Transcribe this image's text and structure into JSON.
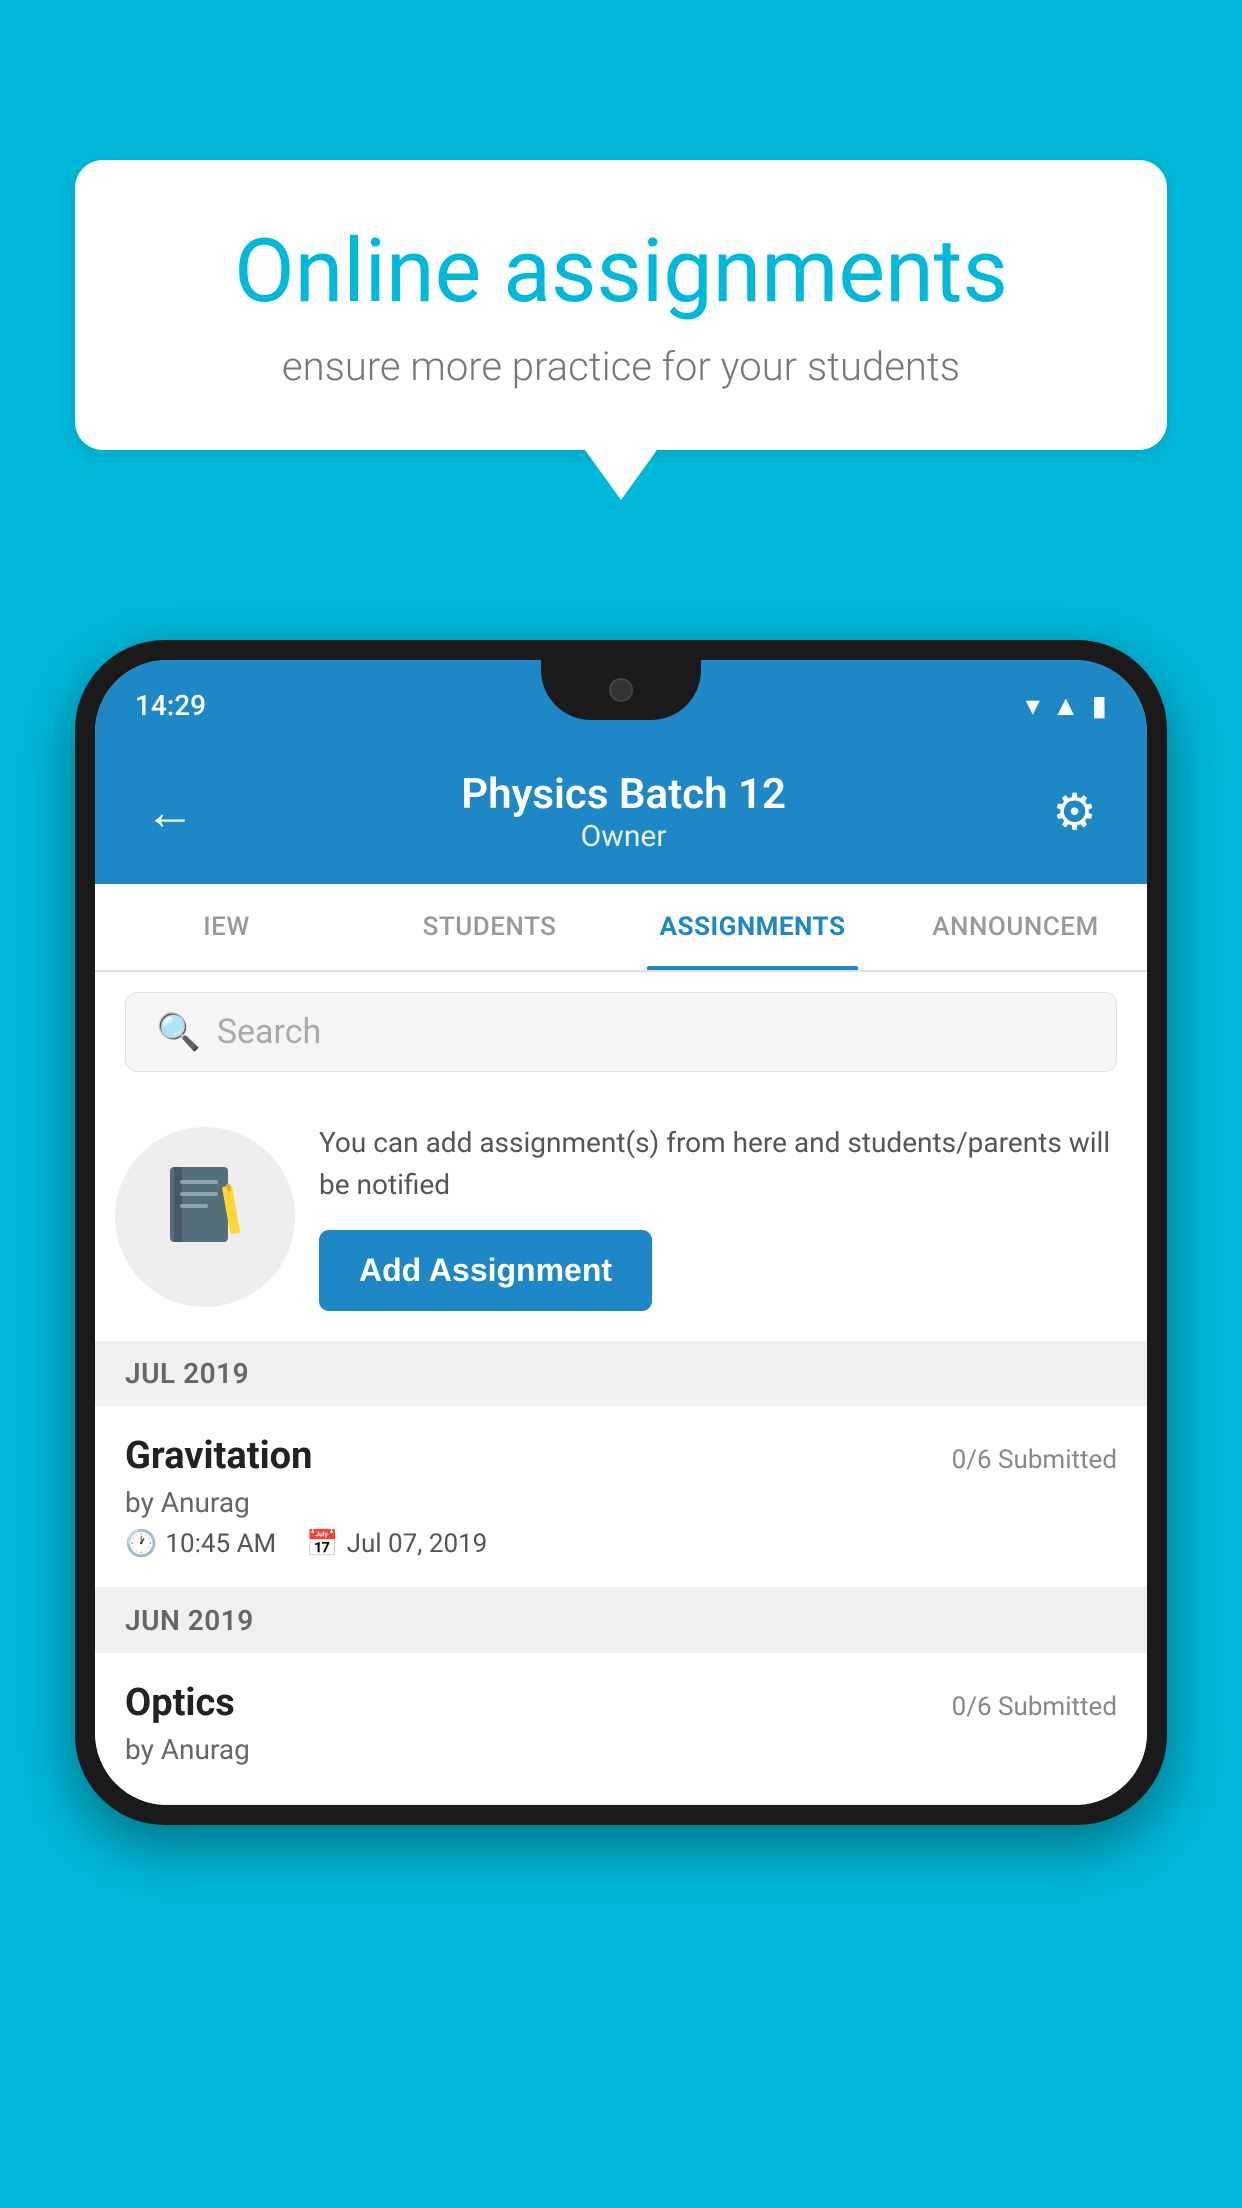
{
  "background_color": "#00b8d9",
  "speech_bubble": {
    "title": "Online assignments",
    "subtitle": "ensure more practice for your students"
  },
  "phone": {
    "status_bar": {
      "time": "14:29",
      "icons": [
        "wifi",
        "signal",
        "battery"
      ]
    },
    "header": {
      "title": "Physics Batch 12",
      "subtitle": "Owner",
      "back_label": "←",
      "gear_label": "⚙"
    },
    "tabs": [
      {
        "label": "IEW",
        "active": false
      },
      {
        "label": "STUDENTS",
        "active": false
      },
      {
        "label": "ASSIGNMENTS",
        "active": true
      },
      {
        "label": "ANNOUNCEM",
        "active": false
      }
    ],
    "search": {
      "placeholder": "Search"
    },
    "promo": {
      "icon": "📓",
      "description": "You can add assignment(s) from here and students/parents will be notified",
      "button_label": "Add Assignment"
    },
    "sections": [
      {
        "month_label": "JUL 2019",
        "assignments": [
          {
            "name": "Gravitation",
            "submitted": "0/6 Submitted",
            "by": "by Anurag",
            "time": "10:45 AM",
            "date": "Jul 07, 2019"
          }
        ]
      },
      {
        "month_label": "JUN 2019",
        "assignments": [
          {
            "name": "Optics",
            "submitted": "0/6 Submitted",
            "by": "by Anurag",
            "time": "",
            "date": ""
          }
        ]
      }
    ]
  }
}
